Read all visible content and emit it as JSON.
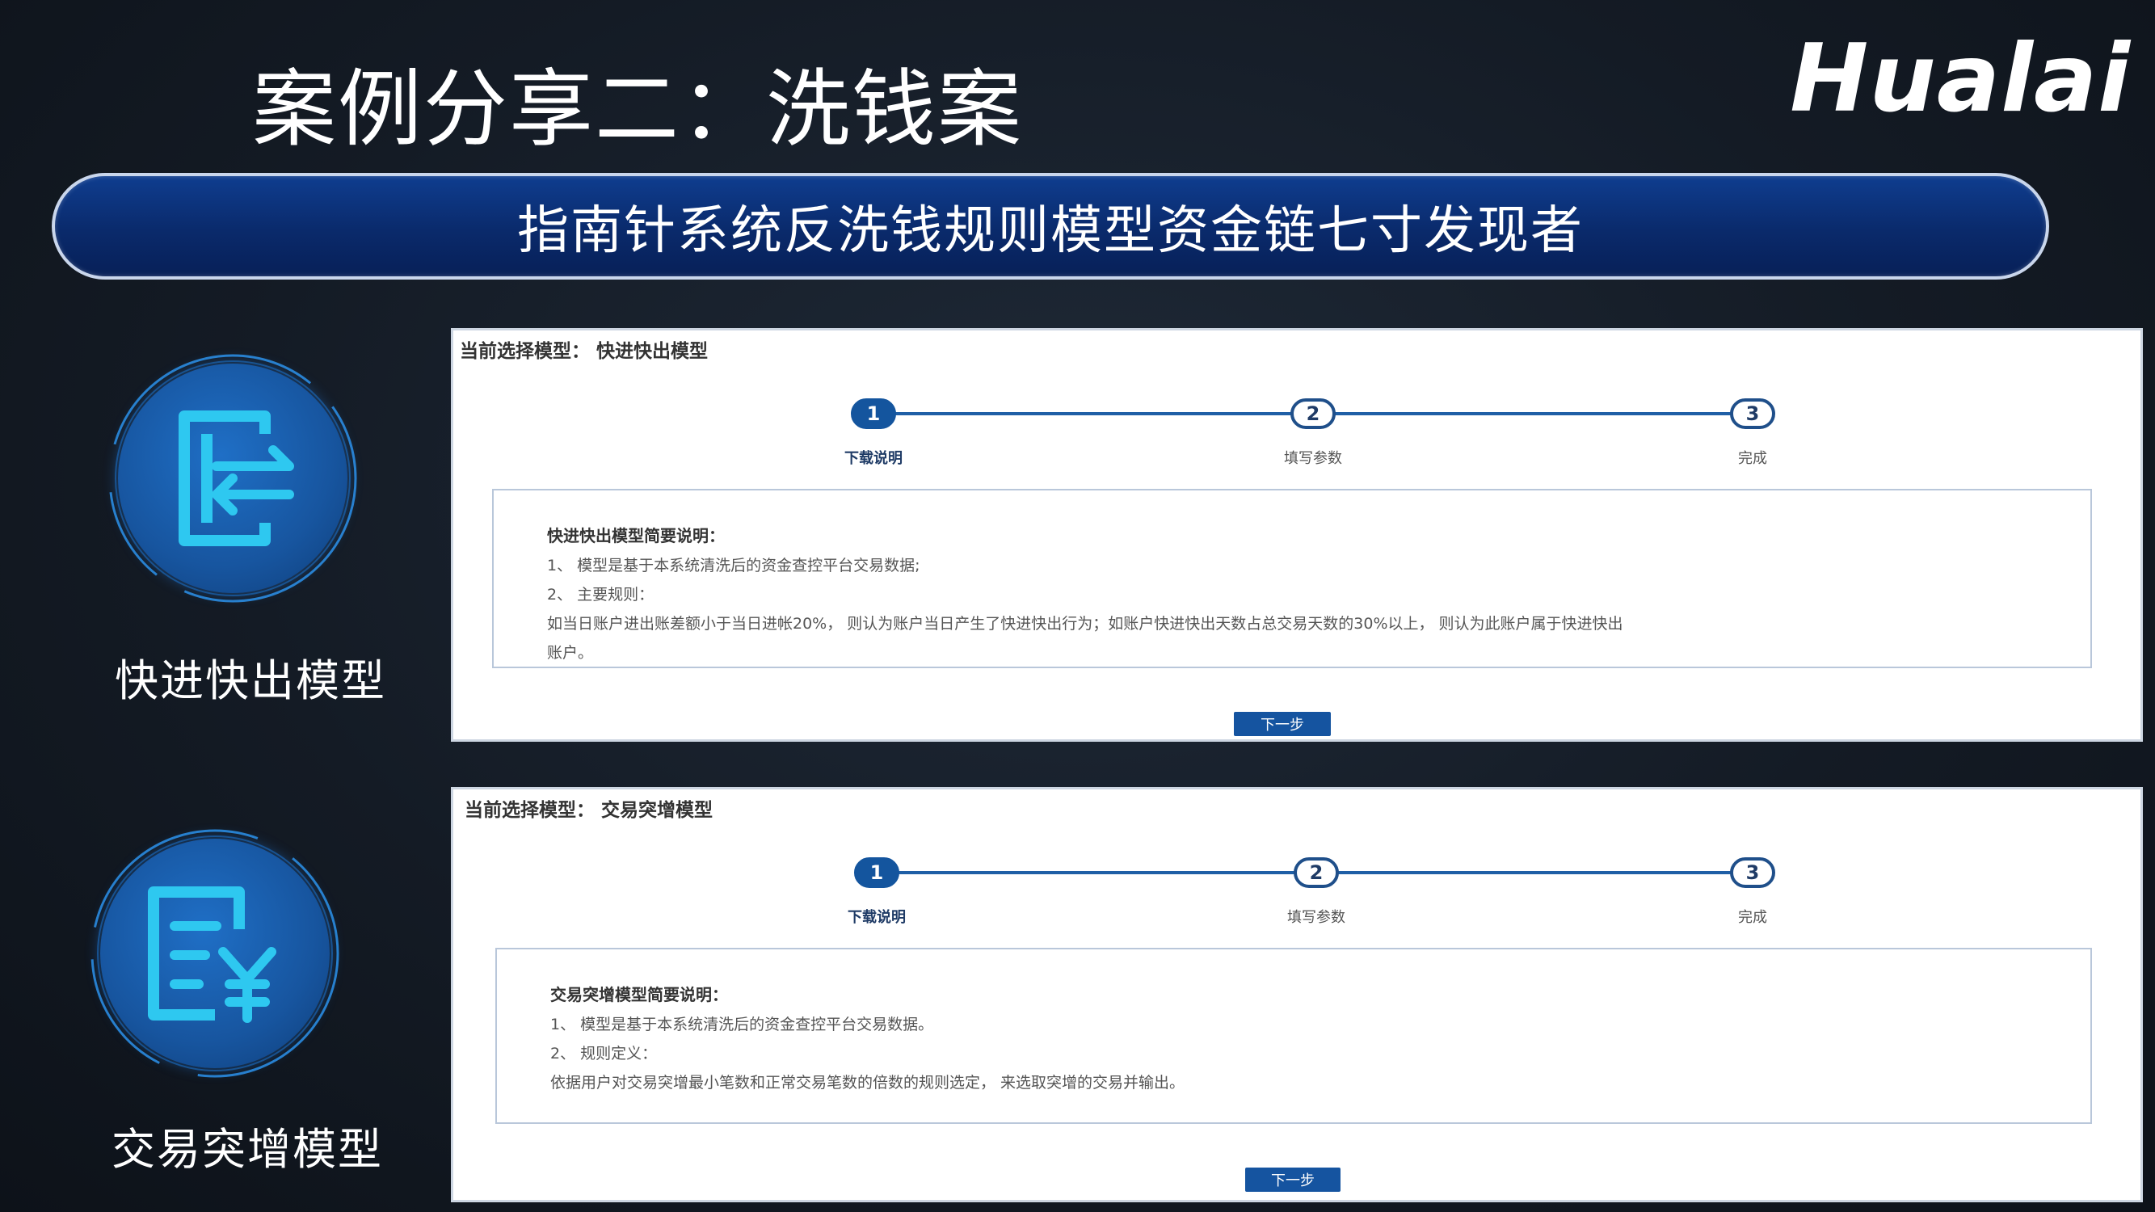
{
  "slide": {
    "title": "案例分享二：洗钱案",
    "brand": "Hualai",
    "banner": "指南针系统反洗钱规则模型资金链七寸发现者"
  },
  "models": [
    {
      "label": "快进快出模型",
      "icon": "exit-arrows-icon",
      "panel": {
        "header": "当前选择模型： 快进快出模型",
        "steps": [
          "下载说明",
          "填写参数",
          "完成"
        ],
        "step_numbers": [
          "1",
          "2",
          "3"
        ],
        "desc_title": "快进快出模型简要说明：",
        "desc_lines": [
          "1、 模型是基于本系统清洗后的资金查控平台交易数据;",
          "2、 主要规则：",
          "如当日账户进出账差额小于当日进帐20%， 则认为账户当日产生了快进快出行为；如账户快进快出天数占总交易天数的30%以上， 则认为此账户属于快进快出",
          "账户。"
        ],
        "next_label": "下一步"
      }
    },
    {
      "label": "交易突增模型",
      "icon": "yuan-document-icon",
      "panel": {
        "header": "当前选择模型： 交易突增模型",
        "steps": [
          "下载说明",
          "填写参数",
          "完成"
        ],
        "step_numbers": [
          "1",
          "2",
          "3"
        ],
        "desc_title": "交易突增模型简要说明：",
        "desc_lines": [
          "1、 模型是基于本系统清洗后的资金查控平台交易数据。",
          "2、 规则定义：",
          "依据用户对交易突增最小笔数和正常交易笔数的倍数的规则选定， 来选取突增的交易并输出。"
        ],
        "next_label": "下一步"
      }
    }
  ]
}
